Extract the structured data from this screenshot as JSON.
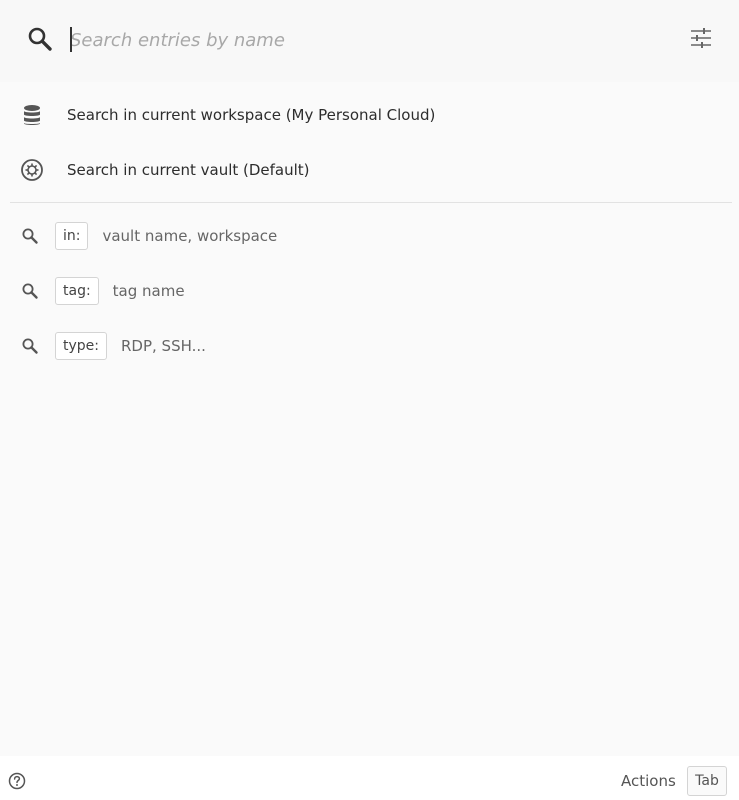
{
  "search": {
    "placeholder": "Search entries by name",
    "value": ""
  },
  "scopes": [
    {
      "label": "Search in current workspace (My Personal Cloud)",
      "icon": "database-icon"
    },
    {
      "label": "Search in current vault (Default)",
      "icon": "vault-icon"
    }
  ],
  "hints": [
    {
      "prefix": "in:",
      "text": "vault name, workspace",
      "icon": "search-icon"
    },
    {
      "prefix": "tag:",
      "text": "tag name",
      "icon": "search-icon"
    },
    {
      "prefix": "type:",
      "text": "RDP, SSH...",
      "icon": "search-icon"
    }
  ],
  "footer": {
    "actions_label": "Actions",
    "key_label": "Tab",
    "help_icon": "help-circle-icon"
  },
  "colors": {
    "background": "#fafafa",
    "header": "#f8f8f8",
    "footer": "#ffffff",
    "icon": "#555555",
    "text": "#2d2d2d",
    "muted": "#666666"
  }
}
